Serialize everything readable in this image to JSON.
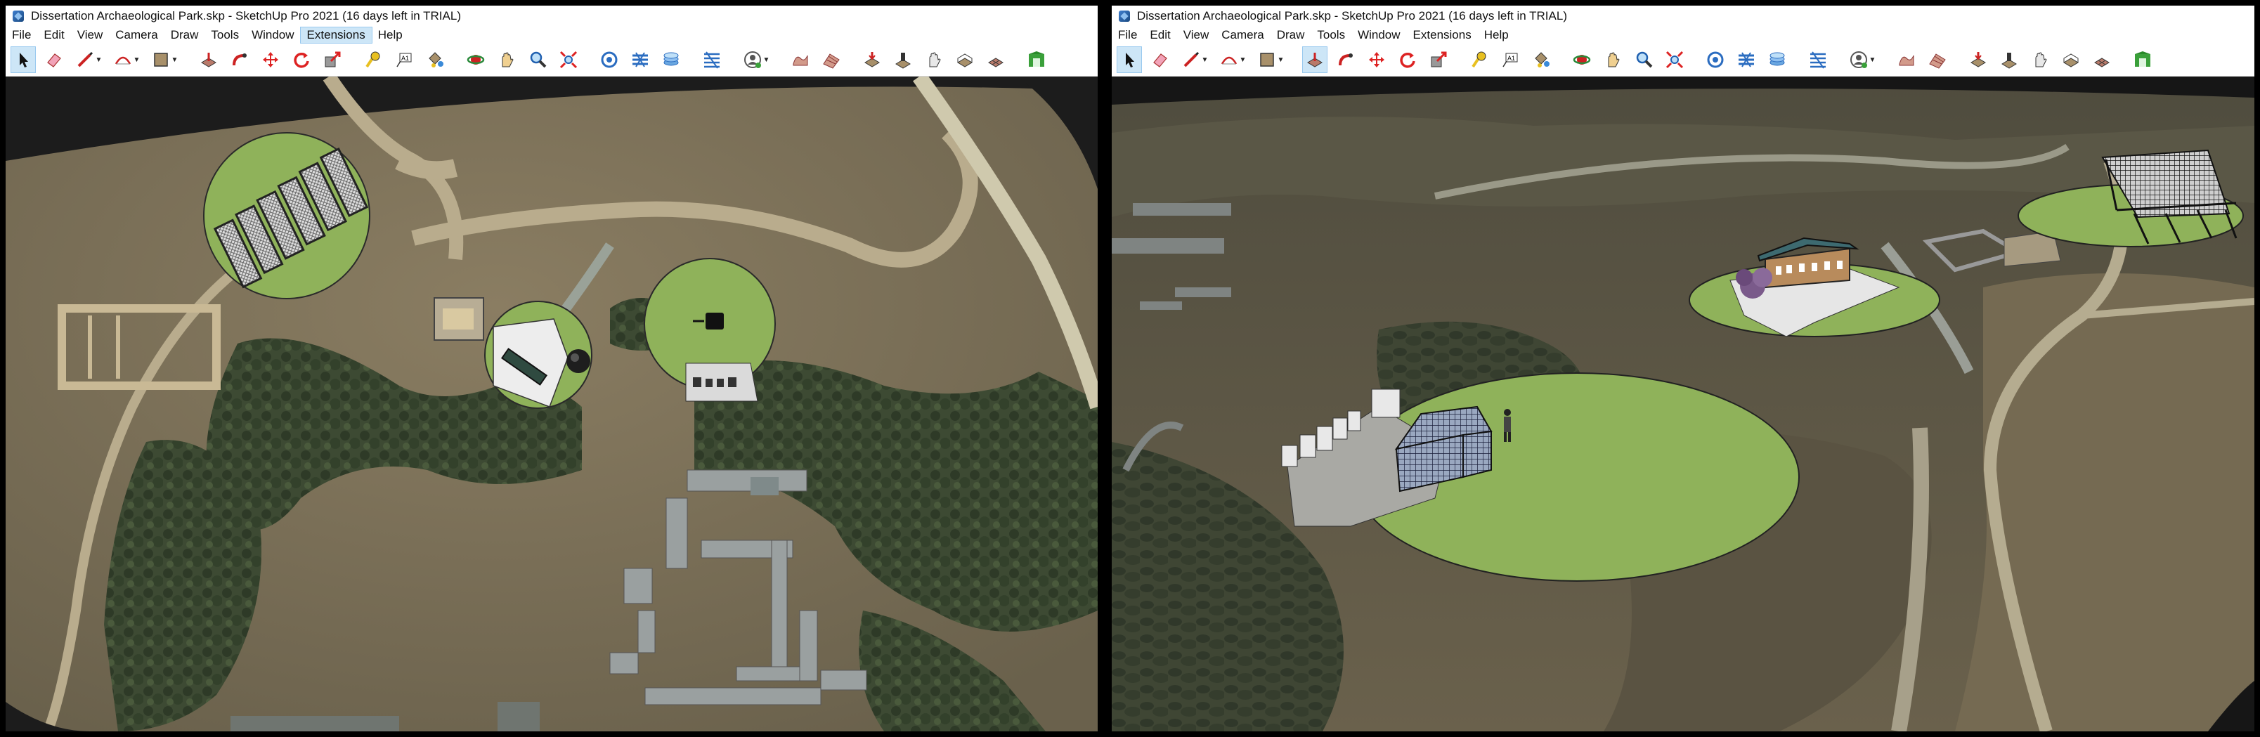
{
  "app": {
    "left_title": "Dissertation Archaeological Park.skp - SketchUp Pro 2021 (16 days left in TRIAL)",
    "right_title": "Dissertation Archaeological Park.skp - SketchUp Pro 2021 (16 days left in TRIAL)"
  },
  "menus": [
    "File",
    "Edit",
    "View",
    "Camera",
    "Draw",
    "Tools",
    "Window",
    "Extensions",
    "Help"
  ],
  "left_active_menu": "Extensions",
  "toolbar_icons": [
    "select-icon",
    "eraser-icon",
    "line-icon",
    "arc-icon",
    "shape-icon",
    "push-pull-icon",
    "follow-me-icon",
    "move-icon",
    "rotate-icon",
    "scale-icon",
    "tape-measure-icon",
    "text-icon",
    "paint-bucket-icon",
    "orbit-icon",
    "pan-icon",
    "zoom-icon",
    "zoom-extents-icon",
    "components-icon",
    "tags-icon",
    "styles-icon",
    "scenes-icon",
    "profile-icon",
    "sandbox-icon",
    "terrain-icon",
    "drape-icon",
    "stamp-icon",
    "flip-icon",
    "smoove-icon",
    "add-detail-icon",
    "extension-warehouse-icon"
  ],
  "colors": {
    "lawn": "#8fb25a",
    "paving": "#ededed",
    "terrain_dark": "#5e5a47",
    "terrain_light": "#8a7d62",
    "path": "#b9ac8d",
    "selection": "#cde6f7"
  }
}
